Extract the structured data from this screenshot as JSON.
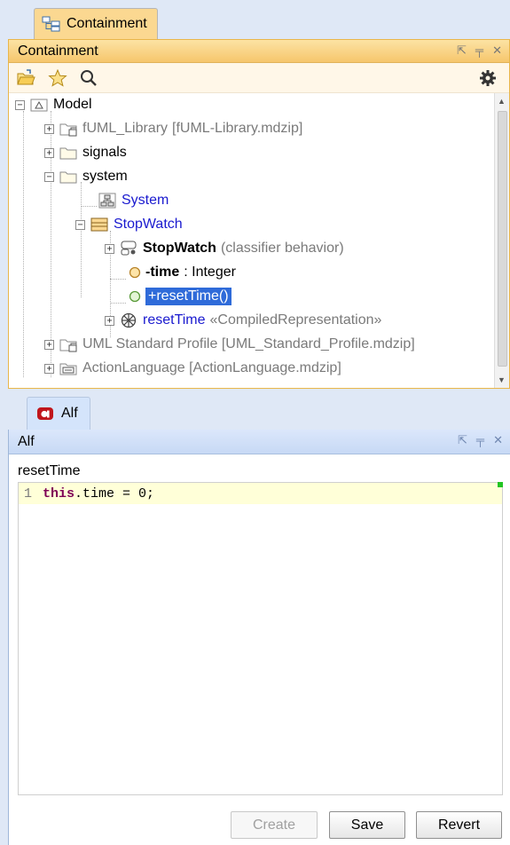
{
  "containment": {
    "tab_label": "Containment",
    "title": "Containment",
    "toolbar": {
      "icons": [
        "open-folder-icon",
        "star-icon",
        "search-icon",
        "gear-icon"
      ]
    },
    "tree": [
      {
        "label": "Model",
        "note": ""
      },
      {
        "label": "fUML_Library",
        "note": " [fUML-Library.mdzip]"
      },
      {
        "label": "signals",
        "note": ""
      },
      {
        "label": "system",
        "note": ""
      },
      {
        "label": "System",
        "note": ""
      },
      {
        "label": "StopWatch",
        "note": ""
      },
      {
        "label": "StopWatch",
        "note": "(classifier behavior)"
      },
      {
        "label": "-time",
        "note": " : Integer"
      },
      {
        "label": "+resetTime()",
        "note": ""
      },
      {
        "label": "resetTime",
        "note": " «CompiledRepresentation»"
      },
      {
        "label": "UML Standard Profile [UML_Standard_Profile.mdzip]",
        "note": ""
      },
      {
        "label": "ActionLanguage [ActionLanguage.mdzip]",
        "note": ""
      }
    ]
  },
  "alf": {
    "tab_label": "Alf",
    "title": "Alf",
    "operation": "resetTime",
    "code_line_number": "1",
    "code_keyword": "this",
    "code_rest": ".time = 0;",
    "buttons": {
      "create": "Create",
      "save": "Save",
      "revert": "Revert"
    }
  },
  "colors": {
    "containment_accent": "#f6c66c",
    "alf_accent": "#c7d9f5",
    "selection": "#2f6bd9",
    "link_blue": "#1a1acf"
  }
}
